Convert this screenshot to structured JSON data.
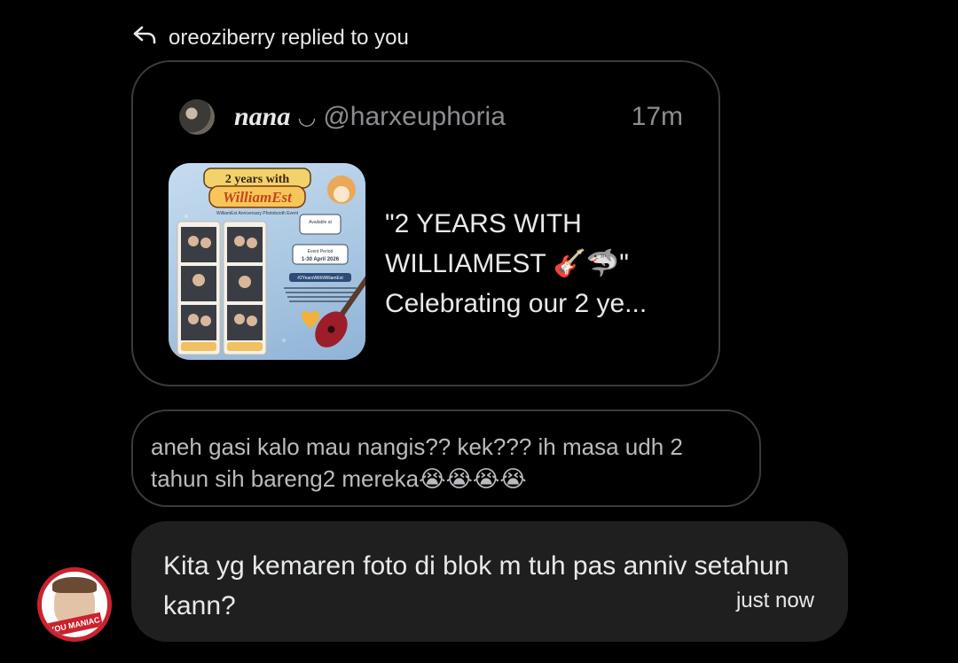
{
  "reply_header": {
    "icon": "reply-arrow-icon",
    "text": "oreoziberry replied to you"
  },
  "quoted_post": {
    "name": "nana",
    "name_suffix": "◡",
    "handle": "@harxeuphoria",
    "time": "17m",
    "text": "\"2 YEARS WITH WILLIAMEST 🎸🦈\" Celebrating our 2 ye...",
    "thumbnail": {
      "title_line1": "2 years with",
      "title_line2": "WilliamEst",
      "subtitle": "WilliamEst Anniversary Photobooth Event",
      "available_label": "Available at",
      "period_label": "Event Period",
      "period_value": "1-30 April 2026",
      "hashtag": "#2YearsWithWilliamEst"
    }
  },
  "my_reply": {
    "text": "aneh gasi kalo mau nangis?? kek??? ih masa udh 2 tahun sih bareng2 mereka😭😭😭😭"
  },
  "incoming_message": {
    "text": "Kita yg kemaren foto di blok m tuh pas anniv setahun kann?",
    "time": "just now"
  },
  "sender_avatar": {
    "banner_text": "YOU MANIAC"
  },
  "colors": {
    "background": "#000000",
    "bubble": "#1f1f1f",
    "border": "#3a3b3c",
    "muted_text": "#8b8d90",
    "avatar_ring": "#c9232e"
  }
}
